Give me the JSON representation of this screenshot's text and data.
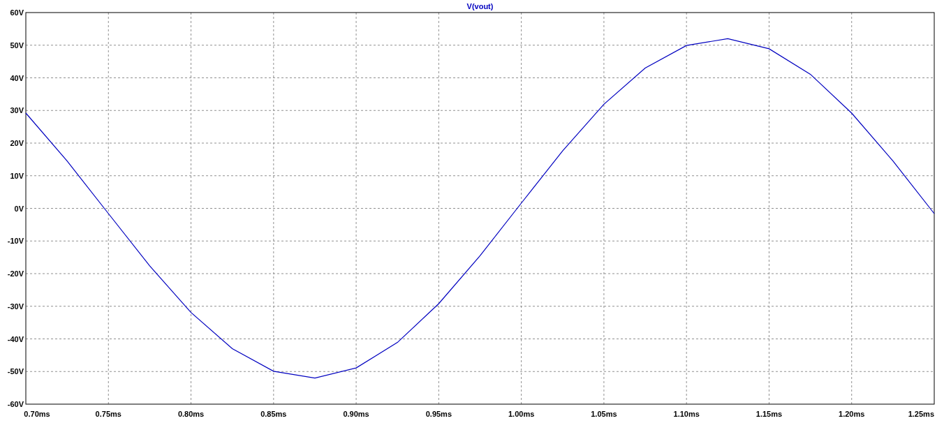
{
  "chart_data": {
    "type": "line",
    "title": "V(vout)",
    "x": [
      0.7,
      0.725,
      0.75,
      0.775,
      0.8,
      0.825,
      0.85,
      0.875,
      0.9,
      0.925,
      0.95,
      0.975,
      1.0,
      1.025,
      1.05,
      1.075,
      1.1,
      1.125,
      1.15,
      1.175,
      1.2,
      1.225,
      1.25
    ],
    "series": [
      {
        "color": "#0000c0",
        "values": [
          29.2,
          14.5,
          -1.6,
          -17.6,
          -31.9,
          -43.0,
          -49.9,
          -52.0,
          -48.9,
          -41.1,
          -29.2,
          -14.5,
          1.6,
          17.6,
          31.9,
          43.0,
          49.9,
          52.0,
          48.9,
          41.1,
          29.2,
          14.5,
          -1.6
        ]
      }
    ],
    "grid": true,
    "xlim": [
      0.7,
      1.25
    ],
    "ylim": [
      -60,
      60
    ],
    "xticks": [
      {
        "value": 0.7,
        "label": "0.70ms"
      },
      {
        "value": 0.75,
        "label": "0.75ms"
      },
      {
        "value": 0.8,
        "label": "0.80ms"
      },
      {
        "value": 0.85,
        "label": "0.85ms"
      },
      {
        "value": 0.9,
        "label": "0.90ms"
      },
      {
        "value": 0.95,
        "label": "0.95ms"
      },
      {
        "value": 1.0,
        "label": "1.00ms"
      },
      {
        "value": 1.05,
        "label": "1.05ms"
      },
      {
        "value": 1.1,
        "label": "1.10ms"
      },
      {
        "value": 1.15,
        "label": "1.15ms"
      },
      {
        "value": 1.2,
        "label": "1.20ms"
      },
      {
        "value": 1.25,
        "label": "1.25ms"
      }
    ],
    "yticks": [
      {
        "value": 60,
        "label": "60V"
      },
      {
        "value": 50,
        "label": "50V"
      },
      {
        "value": 40,
        "label": "40V"
      },
      {
        "value": 30,
        "label": "30V"
      },
      {
        "value": 20,
        "label": "20V"
      },
      {
        "value": 10,
        "label": "10V"
      },
      {
        "value": 0,
        "label": "0V"
      },
      {
        "value": -10,
        "label": "-10V"
      },
      {
        "value": -20,
        "label": "-20V"
      },
      {
        "value": -30,
        "label": "-30V"
      },
      {
        "value": -40,
        "label": "-40V"
      },
      {
        "value": -50,
        "label": "-50V"
      },
      {
        "value": -60,
        "label": "-60V"
      }
    ]
  }
}
